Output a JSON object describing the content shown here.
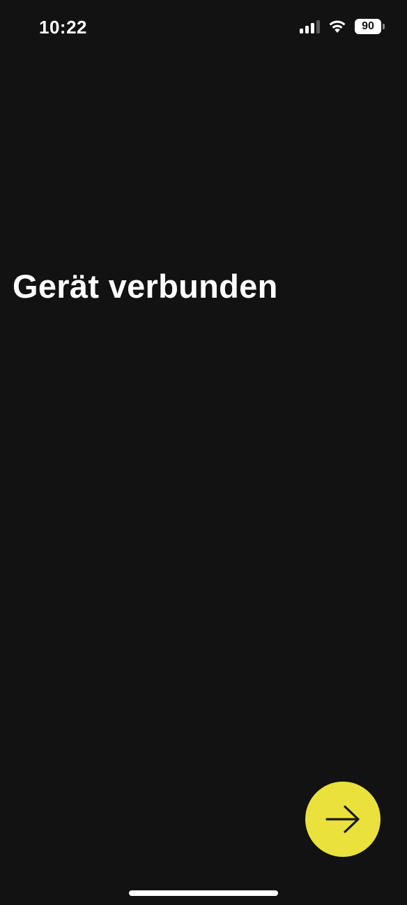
{
  "status_bar": {
    "time": "10:22",
    "battery_level": "90",
    "signal_bars": 3,
    "signal_bars_total": 4,
    "icons": [
      "signal-icon",
      "wifi-icon",
      "battery-icon"
    ]
  },
  "main": {
    "title": "Gerät verbunden"
  },
  "next_button": {
    "icon": "arrow-right-icon",
    "color": "#eae13c"
  },
  "theme": {
    "background": "#121212",
    "text": "#ffffff",
    "accent": "#eae13c"
  }
}
